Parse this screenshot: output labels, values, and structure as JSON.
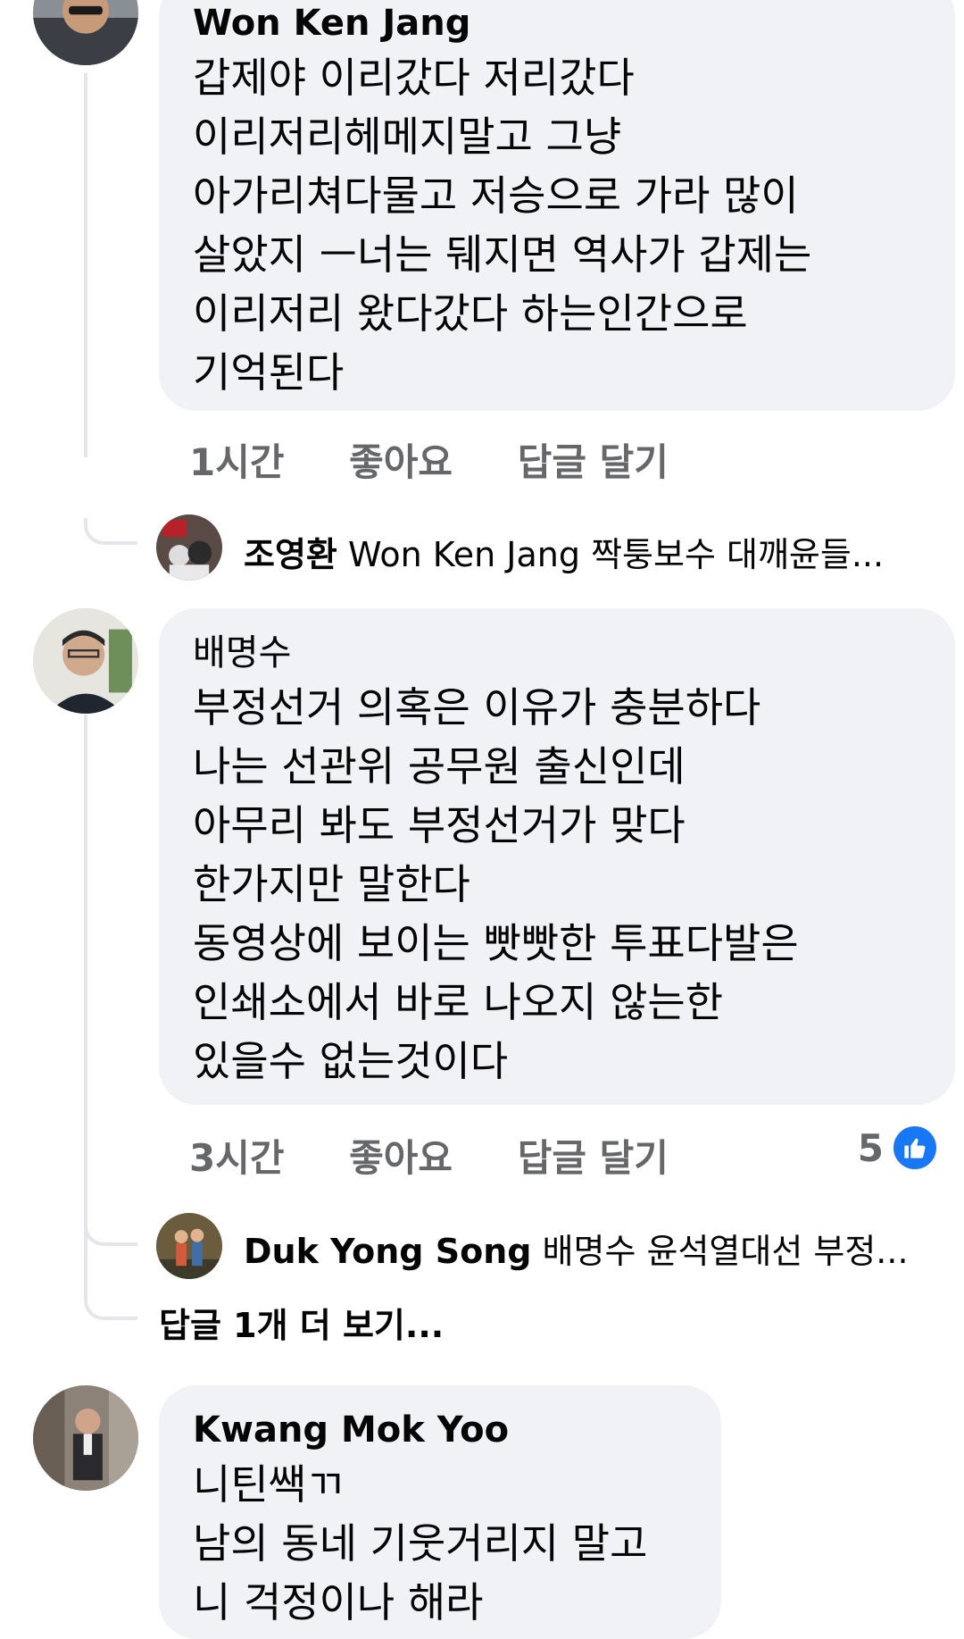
{
  "comments": [
    {
      "author": "Won Ken Jang",
      "text": "갑제야 이리갔다 저리갔다\n이리저리헤메지말고 그냥\n아가리쳐다물고 저승으로 가라 많이\n살았지 ㅡ너는 뒈지면 역사가 갑제는\n이리저리 왔다갔다 하는인간으로\n기억된다",
      "time": "1시간",
      "like_label": "좋아요",
      "reply_label": "답글 달기",
      "reply_preview": {
        "author": "조영환",
        "text": "Won Ken Jang 짝퉁보수 대깨윤들..."
      }
    },
    {
      "author": "배명수",
      "text": "부정선거 의혹은 이유가 충분하다\n나는 선관위 공무원 출신인데\n아무리 봐도 부정선거가 맞다\n한가지만 말한다\n동영상에 보이는 빳빳한 투표다발은\n인쇄소에서 바로 나오지 않는한\n있을수 없는것이다",
      "time": "3시간",
      "like_label": "좋아요",
      "reply_label": "답글 달기",
      "like_count": "5",
      "reply_preview": {
        "author": "Duk Yong Song",
        "text": "배명수 윤석열대선 부정..."
      },
      "more_replies": "답글 1개 더 보기..."
    },
    {
      "author": "Kwang Mok Yoo",
      "text": "니틴쌕ㄲ\n남의 동네 기웃거리지 말고\n니 걱정이나 해라"
    }
  ],
  "colors": {
    "bubble": "#f0f2f5",
    "meta": "#65676b",
    "like": "#1877f2",
    "line": "#e4e6eb"
  }
}
